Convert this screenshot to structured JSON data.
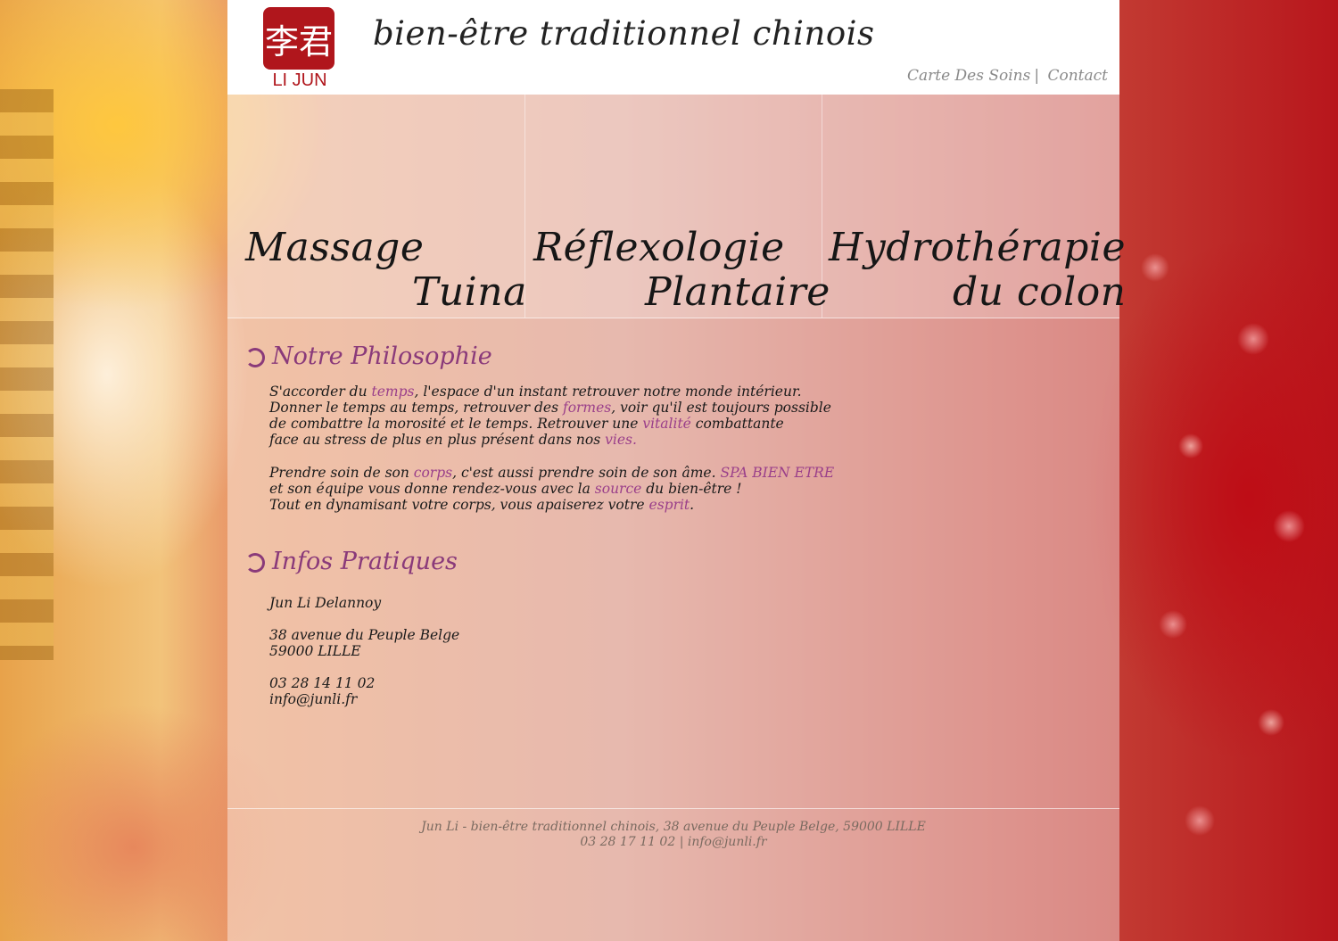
{
  "header": {
    "logo_text": "LI JUN",
    "logo_glyph": "李君",
    "tagline": "bien-être traditionnel chinois",
    "nav": [
      "Carte Des Soins",
      "Contact"
    ],
    "nav_separator": "|"
  },
  "services": [
    {
      "line1": "Massage",
      "line2": "Tuina"
    },
    {
      "line1": "Réflexologie",
      "line2": "Plantaire"
    },
    {
      "line1": "Hydrothérapie",
      "line2": "du colon"
    }
  ],
  "philosophy": {
    "title": "Notre Philosophie",
    "p1_l1_a": "S'accorder du ",
    "p1_l1_hl": "temps",
    "p1_l1_b": ",  l'espace d'un instant retrouver notre monde intérieur.",
    "p1_l2_a": "Donner le temps au temps, retrouver des ",
    "p1_l2_hl": "formes",
    "p1_l2_b": ", voir qu'il est toujours possible",
    "p1_l3_a": "de combattre la morosité et le temps. Retrouver une ",
    "p1_l3_hl": "vitalité",
    "p1_l3_b": " combattante",
    "p1_l4_a": "face au stress de plus en plus présent dans nos ",
    "p1_l4_hl": "vies.",
    "p2_l1_a": "Prendre soin de son ",
    "p2_l1_hl": "corps",
    "p2_l1_b": ", c'est aussi prendre soin de son âme. ",
    "p2_l1_hl2": "SPA BIEN ETRE",
    "p2_l2_a": "et son équipe vous donne rendez-vous avec la ",
    "p2_l2_hl": "source",
    "p2_l2_b": " du bien-être !",
    "p2_l3_a": "Tout en dynamisant votre corps, vous apaiserez votre ",
    "p2_l3_hl": "esprit",
    "p2_l3_b": "."
  },
  "infos": {
    "title": "Infos Pratiques",
    "name": "Jun Li Delannoy",
    "address1": "38 avenue du Peuple Belge",
    "address2": "59000 LILLE",
    "phone": "03 28 14 11 02",
    "email": "info@junli.fr"
  },
  "footer": {
    "line1": "Jun Li - bien-être traditionnel chinois,  38 avenue du Peuple Belge, 59000 LILLE",
    "line2": "03 28 17 11 02 | info@junli.fr"
  },
  "colors": {
    "accent": "#8a3a7a",
    "seal": "#b0161c"
  }
}
